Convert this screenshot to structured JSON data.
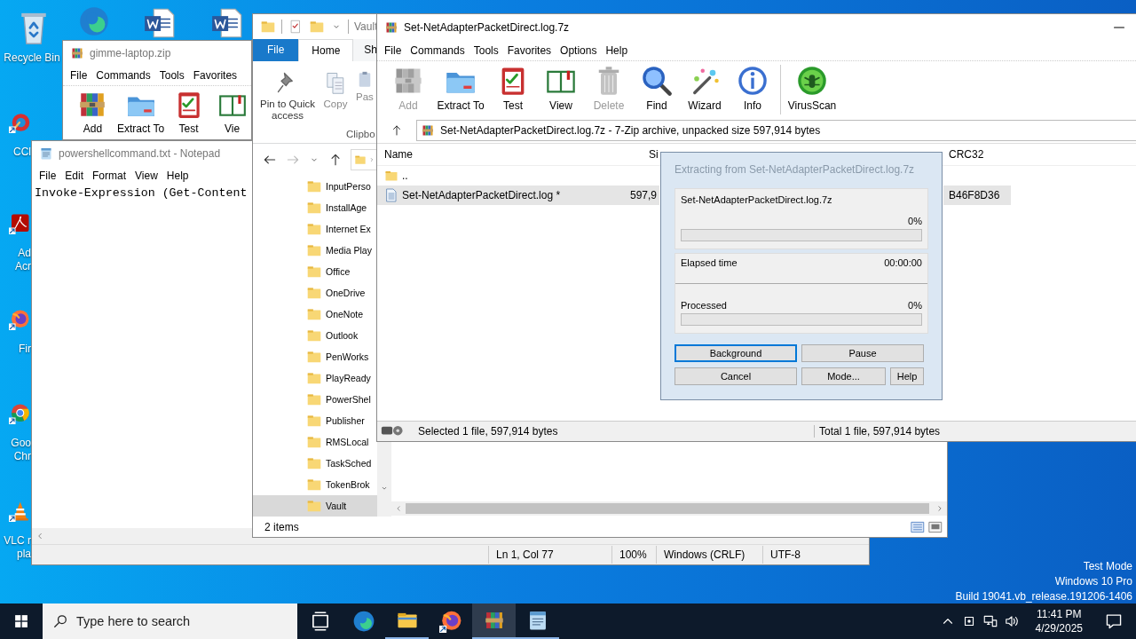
{
  "desktop": {
    "icons": [
      {
        "kind": "recycle",
        "label_lines": [
          "Recycle Bin"
        ]
      },
      {
        "kind": "edge"
      },
      {
        "kind": "word"
      },
      {
        "kind": "word"
      },
      {
        "kind": "ccleaner",
        "label_lines": [
          "CCl"
        ]
      },
      {
        "kind": "acrobat",
        "label_lines": [
          "Ad",
          "Acr"
        ]
      },
      {
        "kind": "firefox",
        "label_lines": [
          "Fir"
        ]
      },
      {
        "kind": "chrome",
        "label_lines": [
          "Goo",
          "Chr"
        ]
      },
      {
        "kind": "vlc",
        "label_lines": [
          "VLC r",
          "pla"
        ]
      }
    ],
    "os_notice": [
      "Test Mode",
      "Windows 10 Pro",
      "Build 19041.vb_release.191206-1406"
    ]
  },
  "archive_window_back": {
    "title": "gimme-laptop.zip",
    "menu": [
      "File",
      "Commands",
      "Tools",
      "Favorites"
    ],
    "toolbar": [
      {
        "kind": "add",
        "label": "Add"
      },
      {
        "kind": "extract",
        "label": "Extract To"
      },
      {
        "kind": "test",
        "label": "Test"
      },
      {
        "kind": "view",
        "label": "Vie"
      }
    ]
  },
  "notepad": {
    "title": "powershellcommand.txt - Notepad",
    "menu": [
      "File",
      "Edit",
      "Format",
      "View",
      "Help"
    ],
    "content": "Invoke-Expression (Get-Content",
    "status": [
      "Ln 1, Col 77",
      "100%",
      "Windows (CRLF)",
      "UTF-8"
    ]
  },
  "explorer": {
    "title": "Vault",
    "tabs": [
      {
        "kind": "menu",
        "label": "File",
        "selected": false
      },
      {
        "kind": "tab",
        "label": "Home",
        "selected": true
      },
      {
        "kind": "tab",
        "label": "Sh",
        "selected": false
      }
    ],
    "ribbon": [
      {
        "kind": "pin",
        "label": "Pin to Quick access"
      },
      {
        "kind": "copy",
        "label": "Copy"
      },
      {
        "kind": "paste",
        "label": "Pas"
      }
    ],
    "ribbon_group": "Clipbo",
    "tree": [
      {
        "name": "InputPerso",
        "selected": false
      },
      {
        "name": "InstallAge",
        "selected": false
      },
      {
        "name": "Internet Ex",
        "selected": false
      },
      {
        "name": "Media Play",
        "selected": false
      },
      {
        "name": "Office",
        "selected": false
      },
      {
        "name": "OneDrive",
        "selected": false
      },
      {
        "name": "OneNote",
        "selected": false
      },
      {
        "name": "Outlook",
        "selected": false
      },
      {
        "name": "PenWorks",
        "selected": false
      },
      {
        "name": "PlayReady",
        "selected": false
      },
      {
        "name": "PowerShel",
        "selected": false
      },
      {
        "name": "Publisher",
        "selected": false
      },
      {
        "name": "RMSLocal",
        "selected": false
      },
      {
        "name": "TaskSched",
        "selected": false
      },
      {
        "name": "TokenBrok",
        "selected": false
      },
      {
        "name": "Vault",
        "selected": true
      }
    ],
    "status": "2 items"
  },
  "archive_window": {
    "title": "Set-NetAdapterPacketDirect.log.7z",
    "menu": [
      "File",
      "Commands",
      "Tools",
      "Favorites",
      "Options",
      "Help"
    ],
    "toolbar": [
      {
        "kind": "add",
        "label": "Add",
        "disabled": true
      },
      {
        "kind": "extract",
        "label": "Extract To",
        "disabled": false
      },
      {
        "kind": "test",
        "label": "Test",
        "disabled": false
      },
      {
        "kind": "view",
        "label": "View",
        "disabled": false
      },
      {
        "kind": "delete",
        "label": "Delete",
        "disabled": true
      },
      {
        "kind": "find",
        "label": "Find",
        "disabled": false
      },
      {
        "kind": "wizard",
        "label": "Wizard",
        "disabled": false
      },
      {
        "kind": "info",
        "label": "Info",
        "disabled": false
      },
      {
        "kind": "virus",
        "label": "VirusScan",
        "disabled": false
      }
    ],
    "address": "Set-NetAdapterPacketDirect.log.7z - 7-Zip archive, unpacked size 597,914 bytes",
    "columns": [
      "Name",
      "Si",
      "CRC32"
    ],
    "rows": [
      {
        "kind": "folder",
        "name": "..",
        "selected": false
      },
      {
        "kind": "file",
        "name": "Set-NetAdapterPacketDirect.log *",
        "size": "597,9",
        "crc32": "B46F8D36",
        "selected": true
      }
    ],
    "status_left": "Selected 1 file, 597,914 bytes",
    "status_right": "Total 1 file, 597,914 bytes"
  },
  "extract_dialog": {
    "title": "Extracting from Set-NetAdapterPacketDirect.log.7z",
    "file": "Set-NetAdapterPacketDirect.log.7z",
    "file_percent": "0%",
    "file_progress": {
      "level": 0
    },
    "elapsed_label": "Elapsed time",
    "elapsed": "00:00:00",
    "processed_label": "Processed",
    "processed_percent": "0%",
    "processed_progress": {
      "level": 0
    },
    "buttons": [
      {
        "label": "Background",
        "focused": true
      },
      {
        "label": "Pause",
        "focused": false
      },
      {
        "label": "Cancel",
        "focused": false
      },
      {
        "label": "Mode...",
        "focused": false
      },
      {
        "label": "Help",
        "focused": false
      }
    ]
  },
  "taskbar": {
    "search": {
      "placeholder": "Type here to search"
    },
    "apps": [
      {
        "kind": "taskview",
        "selected": false,
        "running": false
      },
      {
        "kind": "edge",
        "selected": false,
        "running": false
      },
      {
        "kind": "explorer",
        "selected": false,
        "running": true
      },
      {
        "kind": "firefox",
        "selected": false,
        "running": false
      },
      {
        "kind": "winrar",
        "selected": true,
        "running": true
      },
      {
        "kind": "notepad",
        "selected": false,
        "running": true
      }
    ],
    "time": "11:41 PM",
    "date": "4/29/2025"
  }
}
